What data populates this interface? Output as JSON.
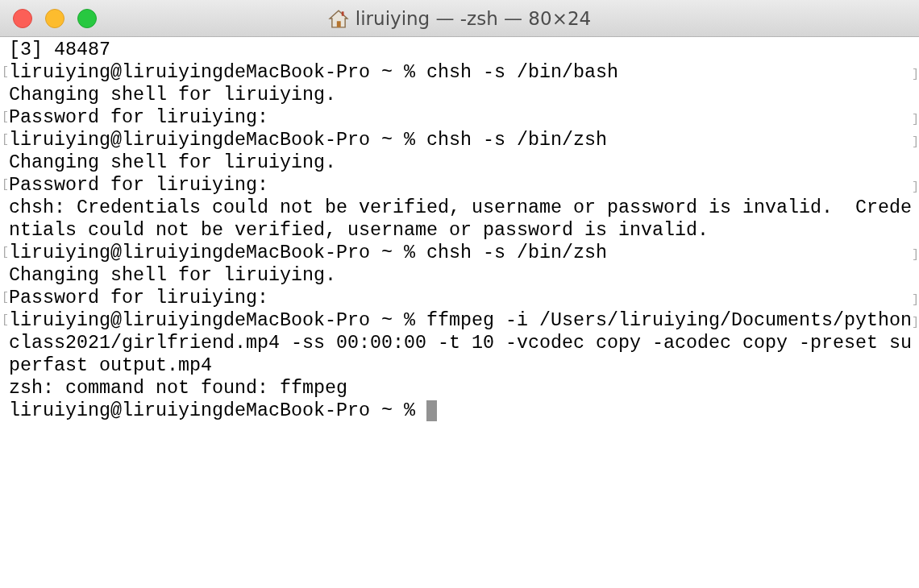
{
  "window": {
    "title": "liruiying — -zsh — 80×24"
  },
  "lines": [
    {
      "text": "[3] 48487"
    },
    {
      "left_mark": "[",
      "text": "liruiying@liruiyingdeMacBook-Pro ~ % chsh -s /bin/bash",
      "right_mark": "]"
    },
    {
      "text": "Changing shell for liruiying."
    },
    {
      "left_mark": "[",
      "text": "Password for liruiying:",
      "right_mark": "]"
    },
    {
      "left_mark": "[",
      "text": "liruiying@liruiyingdeMacBook-Pro ~ % chsh -s /bin/zsh",
      "right_mark": "]"
    },
    {
      "text": "Changing shell for liruiying."
    },
    {
      "left_mark": "[",
      "text": "Password for liruiying:",
      "right_mark": "]"
    },
    {
      "text": "chsh: Credentials could not be verified, username or password is invalid.  Crede"
    },
    {
      "text": "ntials could not be verified, username or password is invalid."
    },
    {
      "left_mark": "[",
      "text": "liruiying@liruiyingdeMacBook-Pro ~ % chsh -s /bin/zsh",
      "right_mark": "]"
    },
    {
      "text": "Changing shell for liruiying."
    },
    {
      "left_mark": "[",
      "text": "Password for liruiying:",
      "right_mark": "]"
    },
    {
      "left_mark": "[",
      "text": "liruiying@liruiyingdeMacBook-Pro ~ % ffmpeg -i /Users/liruiying/Documents/python",
      "right_mark": "]"
    },
    {
      "text": "class2021/girlfriend.mp4 -ss 00:00:00 -t 10 -vcodec copy -acodec copy -preset su"
    },
    {
      "text": "perfast output.mp4"
    },
    {
      "text": "zsh: command not found: ffmpeg"
    },
    {
      "text": "liruiying@liruiyingdeMacBook-Pro ~ % ",
      "cursor": true
    }
  ]
}
